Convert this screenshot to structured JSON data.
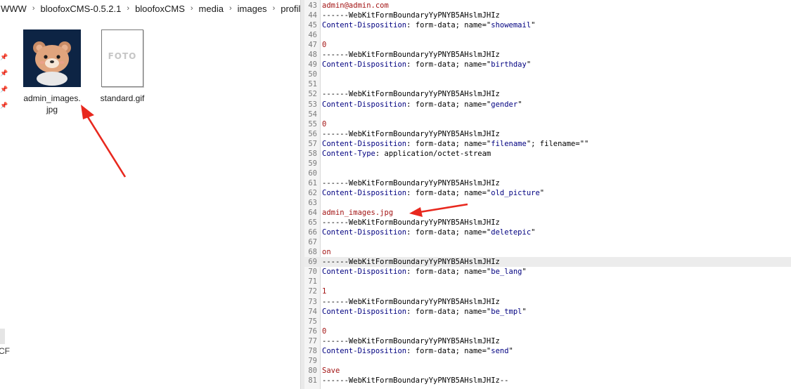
{
  "explorer": {
    "breadcrumb": [
      "WWW",
      "bloofoxCMS-0.5.2.1",
      "bloofoxCMS",
      "media",
      "images",
      "profiles"
    ],
    "breadcrumb_separator": "›",
    "files": [
      {
        "name": "admin_images.jpg",
        "thumbnail": "bear-avatar-image"
      },
      {
        "name": "standard.gif",
        "thumbnail": "foto-placeholder-image",
        "thumbnail_text": "FOTO"
      }
    ],
    "nav_stub_text": "CF",
    "pin_icon": "pin-icon"
  },
  "editor": {
    "highlighted_line": 69,
    "lines": [
      {
        "n": "43",
        "kind": "value",
        "text": "admin@admin.com"
      },
      {
        "n": "44",
        "kind": "boundary",
        "text": "------WebKitFormBoundaryYyPNYB5AHslmJHIz"
      },
      {
        "n": "45",
        "kind": "disposition",
        "name": "showemail"
      },
      {
        "n": "46",
        "kind": "blank",
        "text": ""
      },
      {
        "n": "47",
        "kind": "value",
        "text": "0"
      },
      {
        "n": "48",
        "kind": "boundary",
        "text": "------WebKitFormBoundaryYyPNYB5AHslmJHIz"
      },
      {
        "n": "49",
        "kind": "disposition",
        "name": "birthday"
      },
      {
        "n": "50",
        "kind": "blank",
        "text": ""
      },
      {
        "n": "51",
        "kind": "blank",
        "text": ""
      },
      {
        "n": "52",
        "kind": "boundary",
        "text": "------WebKitFormBoundaryYyPNYB5AHslmJHIz"
      },
      {
        "n": "53",
        "kind": "disposition",
        "name": "gender"
      },
      {
        "n": "54",
        "kind": "blank",
        "text": ""
      },
      {
        "n": "55",
        "kind": "value",
        "text": "0"
      },
      {
        "n": "56",
        "kind": "boundary",
        "text": "------WebKitFormBoundaryYyPNYB5AHslmJHIz"
      },
      {
        "n": "57",
        "kind": "disposition-file",
        "name": "filename",
        "filename": ""
      },
      {
        "n": "58",
        "kind": "content-type",
        "value": "application/octet-stream"
      },
      {
        "n": "59",
        "kind": "blank",
        "text": ""
      },
      {
        "n": "60",
        "kind": "blank",
        "text": ""
      },
      {
        "n": "61",
        "kind": "boundary",
        "text": "------WebKitFormBoundaryYyPNYB5AHslmJHIz"
      },
      {
        "n": "62",
        "kind": "disposition",
        "name": "old_picture"
      },
      {
        "n": "63",
        "kind": "blank",
        "text": ""
      },
      {
        "n": "64",
        "kind": "value",
        "text": "admin_images.jpg"
      },
      {
        "n": "65",
        "kind": "boundary",
        "text": "------WebKitFormBoundaryYyPNYB5AHslmJHIz"
      },
      {
        "n": "66",
        "kind": "disposition",
        "name": "deletepic"
      },
      {
        "n": "67",
        "kind": "blank",
        "text": ""
      },
      {
        "n": "68",
        "kind": "value",
        "text": "on"
      },
      {
        "n": "69",
        "kind": "boundary",
        "text": "------WebKitFormBoundaryYyPNYB5AHslmJHIz"
      },
      {
        "n": "70",
        "kind": "disposition",
        "name": "be_lang"
      },
      {
        "n": "71",
        "kind": "blank",
        "text": ""
      },
      {
        "n": "72",
        "kind": "value",
        "text": "1"
      },
      {
        "n": "73",
        "kind": "boundary",
        "text": "------WebKitFormBoundaryYyPNYB5AHslmJHIz"
      },
      {
        "n": "74",
        "kind": "disposition",
        "name": "be_tmpl"
      },
      {
        "n": "75",
        "kind": "blank",
        "text": ""
      },
      {
        "n": "76",
        "kind": "value",
        "text": "0"
      },
      {
        "n": "77",
        "kind": "boundary",
        "text": "------WebKitFormBoundaryYyPNYB5AHslmJHIz"
      },
      {
        "n": "78",
        "kind": "disposition",
        "name": "send"
      },
      {
        "n": "79",
        "kind": "blank",
        "text": ""
      },
      {
        "n": "80",
        "kind": "value",
        "text": "Save"
      },
      {
        "n": "81",
        "kind": "boundary",
        "text": "------WebKitFormBoundaryYyPNYB5AHslmJHIz--"
      }
    ],
    "tokens": {
      "content_disposition": "Content-Disposition",
      "form_data": "form-data; name=",
      "filename_attr": "; filename=",
      "content_type": "Content-Type"
    }
  },
  "annotations": [
    {
      "name": "annotation-arrow-file",
      "target": "admin_images.jpg",
      "color": "#e8281e"
    },
    {
      "name": "annotation-arrow-code",
      "target": "admin_images.jpg",
      "color": "#e8281e"
    }
  ]
}
